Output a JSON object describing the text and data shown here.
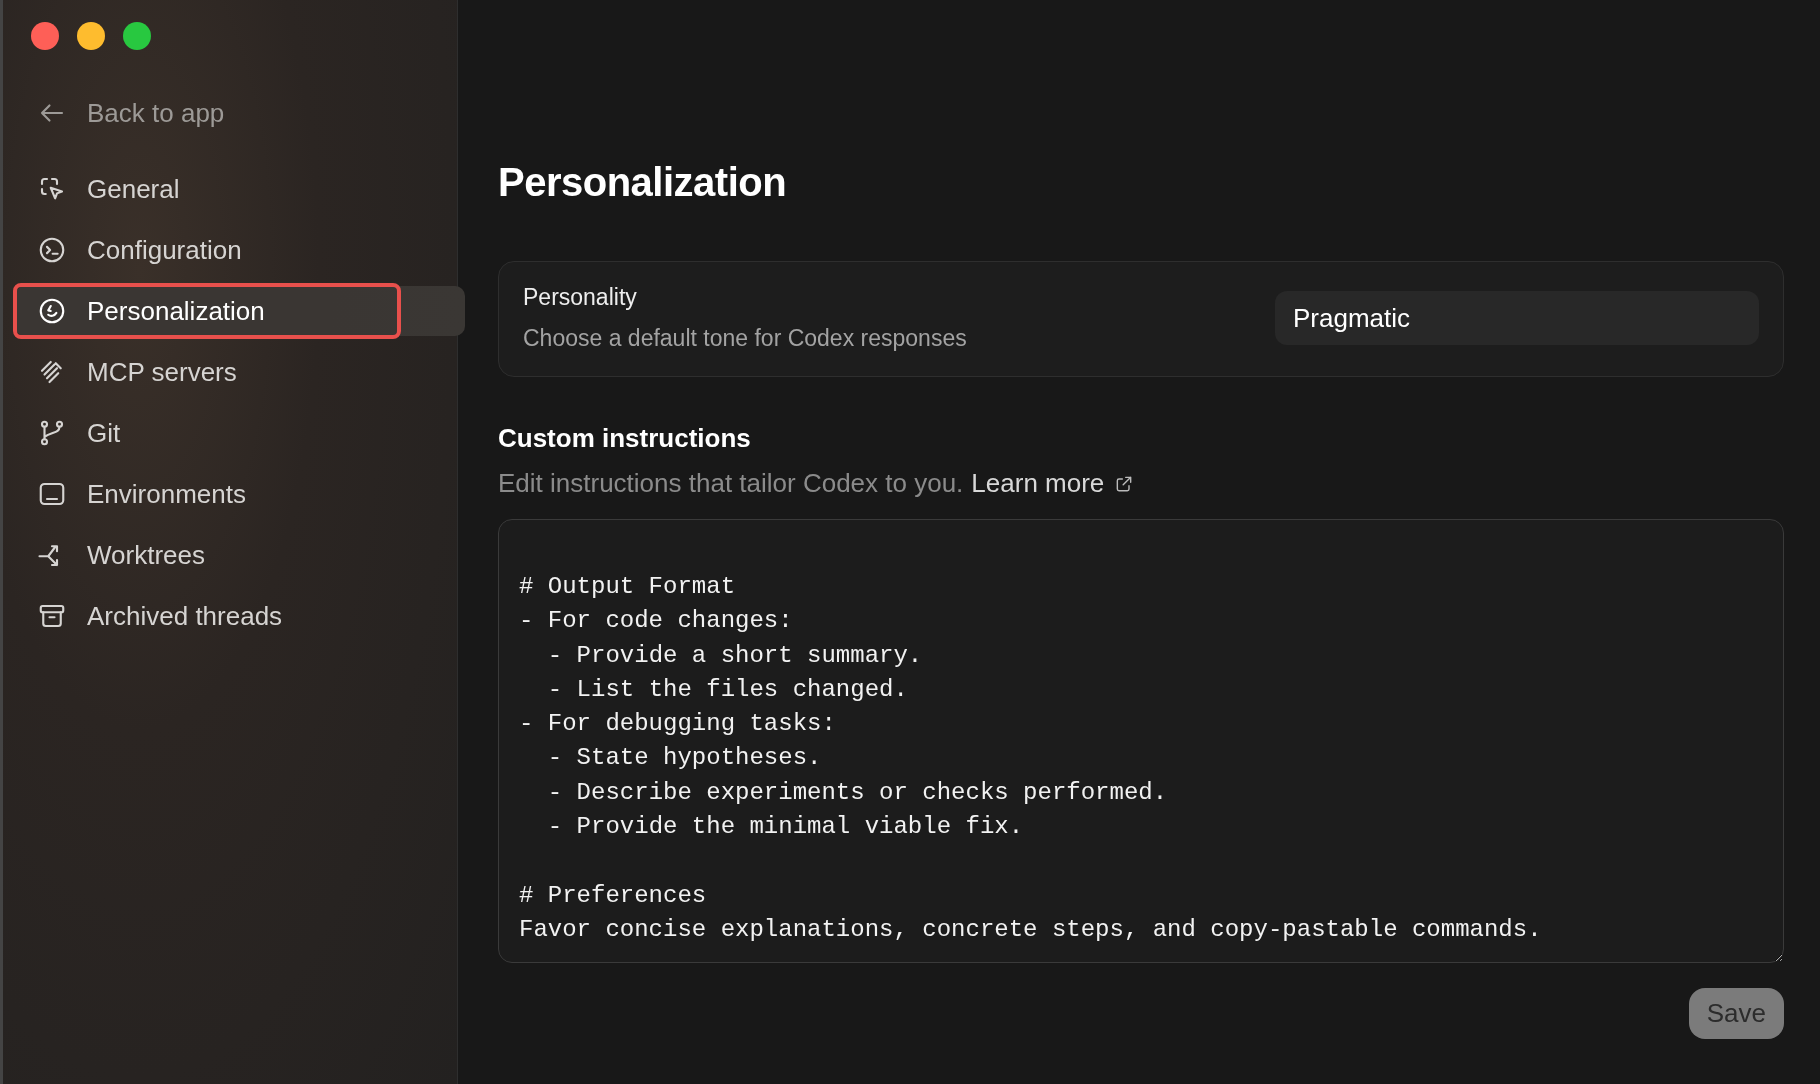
{
  "window": {
    "traffic_lights": [
      {
        "color": "#fe5f57"
      },
      {
        "color": "#febc2e"
      },
      {
        "color": "#28c840"
      }
    ]
  },
  "sidebar": {
    "back": {
      "label": "Back to app"
    },
    "items": [
      {
        "label": "General",
        "kind": "general",
        "selected": false,
        "annotated": false
      },
      {
        "label": "Configuration",
        "kind": "terminal",
        "selected": false,
        "annotated": false
      },
      {
        "label": "Personalization",
        "kind": "smile",
        "selected": true,
        "annotated": true
      },
      {
        "label": "MCP servers",
        "kind": "mcp",
        "selected": false,
        "annotated": false
      },
      {
        "label": "Git",
        "kind": "git",
        "selected": false,
        "annotated": false
      },
      {
        "label": "Environments",
        "kind": "env",
        "selected": false,
        "annotated": false
      },
      {
        "label": "Worktrees",
        "kind": "worktree",
        "selected": false,
        "annotated": false
      },
      {
        "label": "Archived threads",
        "kind": "archive",
        "selected": false,
        "annotated": false
      }
    ]
  },
  "page": {
    "title": "Personalization",
    "personality": {
      "label": "Personality",
      "description": "Choose a default tone for Codex responses",
      "value": "Pragmatic"
    },
    "custom_instructions": {
      "heading": "Custom instructions",
      "description": "Edit instructions that tailor Codex to you.",
      "link": "Learn more",
      "value": "# Output Format\n- For code changes:\n  - Provide a short summary.\n  - List the files changed.\n- For debugging tasks:\n  - State hypotheses.\n  - Describe experiments or checks performed.\n  - Provide the minimal viable fix.\n\n# Preferences\nFavor concise explanations, concrete steps, and copy-pastable commands."
    },
    "save_button": {
      "label": "Save",
      "disabled": true
    }
  }
}
